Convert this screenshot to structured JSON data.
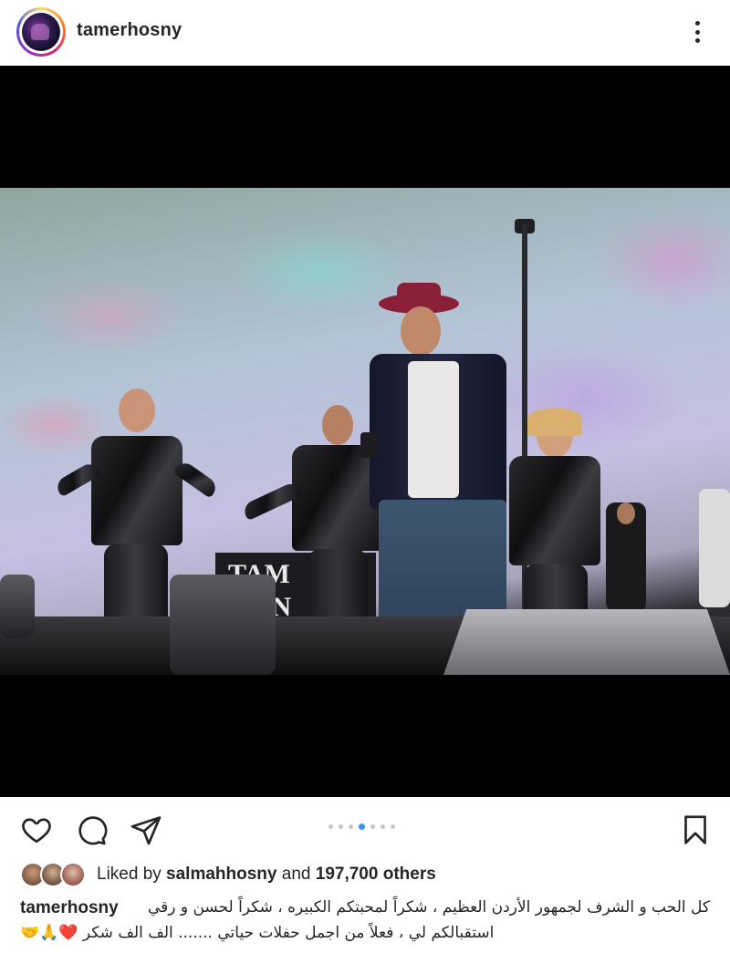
{
  "header": {
    "username": "tamerhosny",
    "more_icon": "more-vertical-icon"
  },
  "media": {
    "stage_sign_text": "TAM\nOSN",
    "carousel_total": 7,
    "carousel_active_index": 3
  },
  "actions": {
    "like_icon": "heart-outline-icon",
    "comment_icon": "comment-bubble-icon",
    "share_icon": "paper-plane-icon",
    "save_icon": "bookmark-icon"
  },
  "likes": {
    "prefix": "Liked by ",
    "user": "salmahhosny",
    "middle": " and ",
    "count": "197,700 others"
  },
  "caption": {
    "username": "tamerhosny",
    "line1": "كل الحب و الشرف لجمهور الأردن العظيم ، شكراً لمحبتكم الكبيره ، شكراً لحسن و رقي",
    "line2": "استقبالكم لي ، فعلاً من اجمل حفلات حياتي ....... الف الف شكر ❤️🙏🤝"
  },
  "colors": {
    "text": "#262626",
    "carousel_active": "#3897f0",
    "carousel_inactive": "#c7c7c7"
  }
}
